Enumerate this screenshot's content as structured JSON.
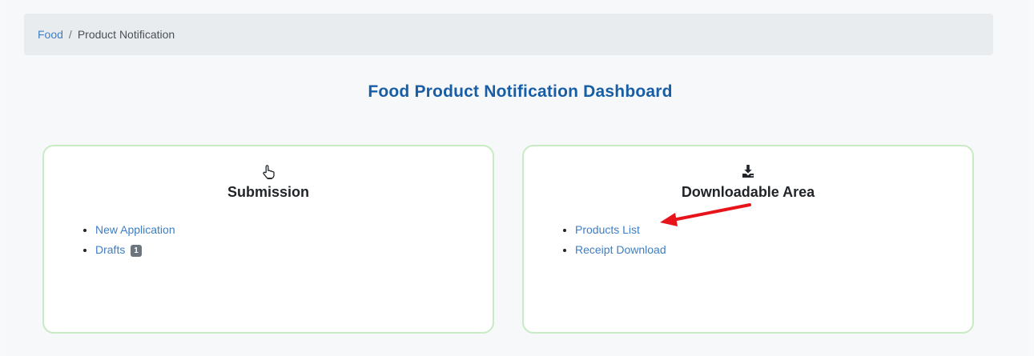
{
  "breadcrumb": {
    "home": "Food",
    "separator": "/",
    "current": "Product Notification"
  },
  "page": {
    "title": "Food Product Notification Dashboard"
  },
  "cards": {
    "submission": {
      "icon": "pointer-hand-icon",
      "title": "Submission",
      "items": [
        {
          "label": "New Application"
        },
        {
          "label": "Drafts",
          "badge": "1"
        }
      ]
    },
    "downloads": {
      "icon": "download-icon",
      "title": "Downloadable Area",
      "items": [
        {
          "label": "Products List"
        },
        {
          "label": "Receipt Download"
        }
      ]
    }
  },
  "colors": {
    "link": "#3d7ec5",
    "title": "#175ea6",
    "card_border": "#c8eac4",
    "annotation_arrow": "#e8141b"
  }
}
